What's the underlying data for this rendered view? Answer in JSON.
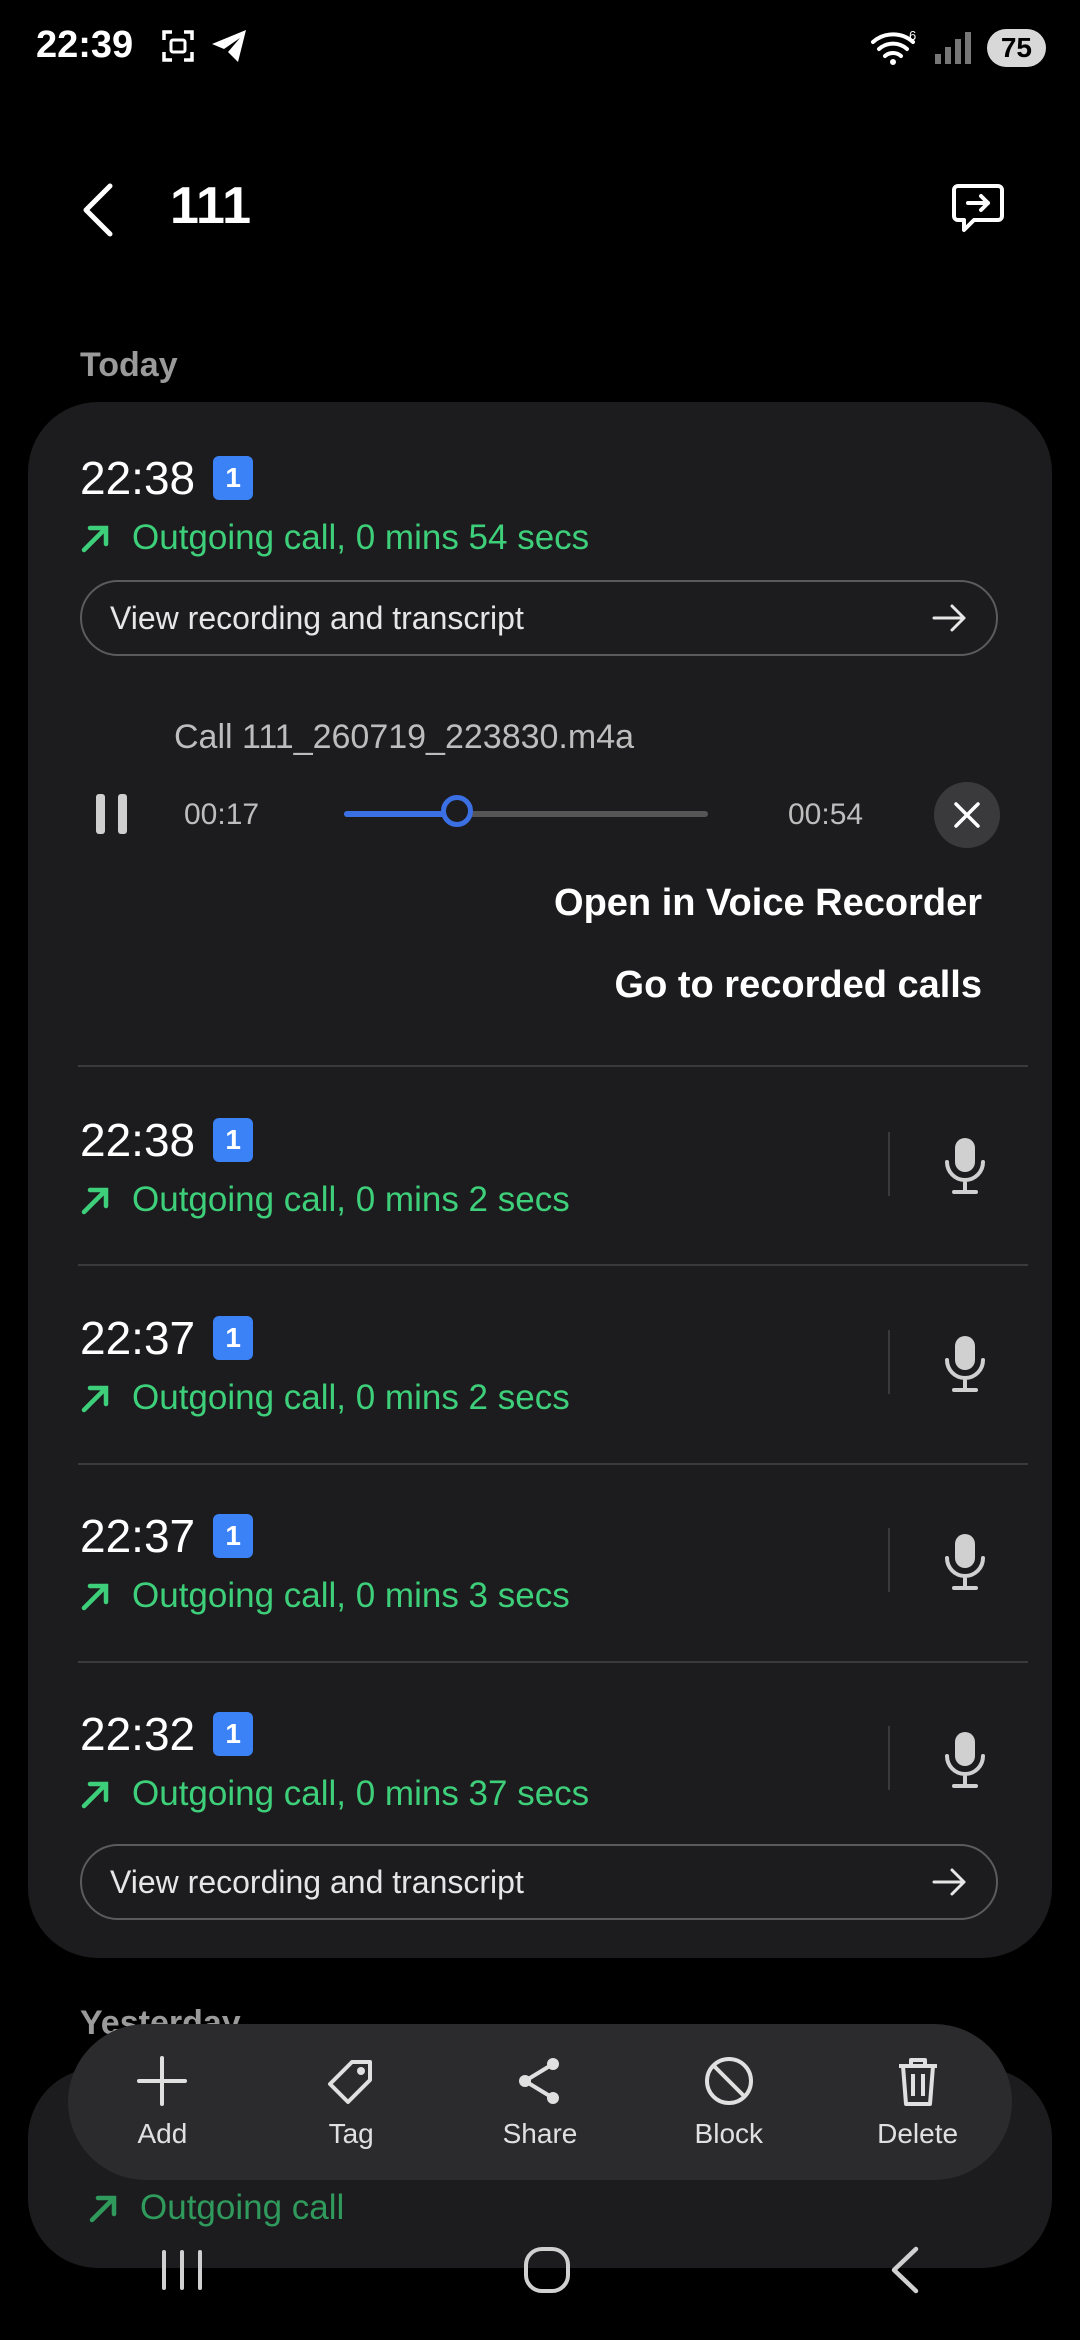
{
  "status_bar": {
    "time": "22:39",
    "battery": "75",
    "wifi_badge": "6"
  },
  "header": {
    "title": "111"
  },
  "sections": {
    "today": "Today",
    "yesterday": "Yesterday"
  },
  "expanded_entry": {
    "time": "22:38",
    "sim": "1",
    "call_text": "Outgoing call, 0 mins 54 secs",
    "view_button": "View recording and transcript",
    "player": {
      "file_name": "Call 111_260719_223830.m4a",
      "elapsed": "00:17",
      "total": "00:54",
      "progress_fraction": 0.31
    },
    "open_voice_recorder": "Open in Voice Recorder",
    "go_to_recorded_calls": "Go to recorded calls"
  },
  "entries": [
    {
      "time": "22:38",
      "sim": "1",
      "call_text": "Outgoing call, 0 mins 2 secs"
    },
    {
      "time": "22:37",
      "sim": "1",
      "call_text": "Outgoing call, 0 mins 2 secs"
    },
    {
      "time": "22:37",
      "sim": "1",
      "call_text": "Outgoing call, 0 mins 3 secs"
    },
    {
      "time": "22:32",
      "sim": "1",
      "call_text": "Outgoing call, 0 mins 37 secs",
      "view_button": "View recording and transcript"
    }
  ],
  "yesterday_entry": {
    "call_text": "Outgoing call"
  },
  "actions": {
    "add": "Add",
    "tag": "Tag",
    "share": "Share",
    "block": "Block",
    "delete": "Delete"
  },
  "colors": {
    "accent_green": "#3ecf7a",
    "accent_blue": "#3b82f6",
    "card_bg": "#1c1c1e"
  }
}
